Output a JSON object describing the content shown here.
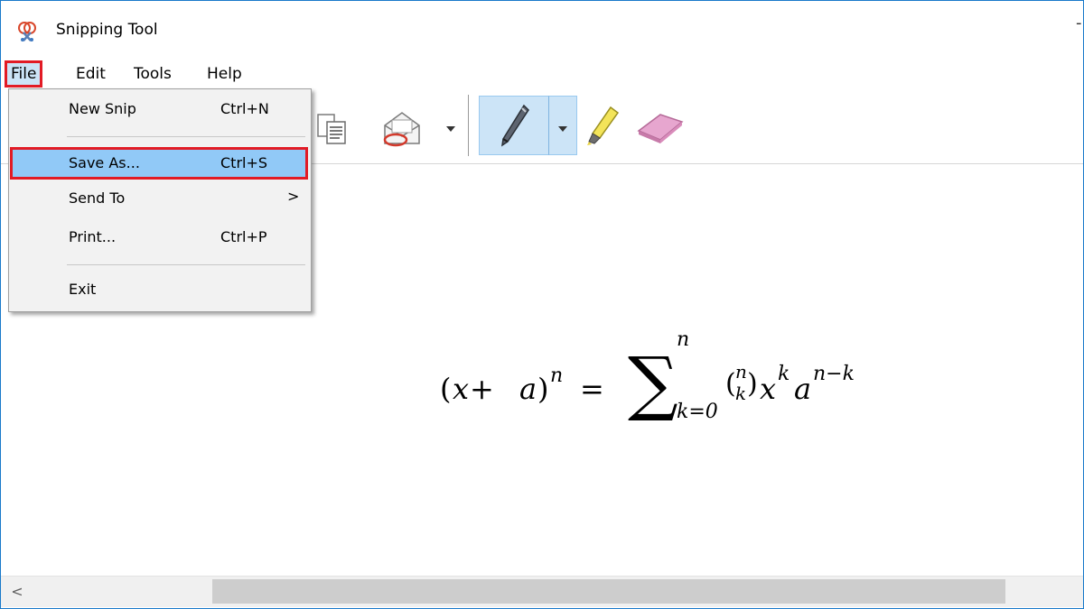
{
  "window": {
    "title": "Snipping Tool",
    "control_glyph": "-",
    "frame_color": "#1979ca"
  },
  "menubar": {
    "items": [
      {
        "label": "File"
      },
      {
        "label": "Edit"
      },
      {
        "label": "Tools"
      },
      {
        "label": "Help"
      }
    ]
  },
  "file_menu": {
    "items": [
      {
        "label": "New Snip",
        "shortcut": "Ctrl+N"
      },
      {
        "label": "Save As...",
        "shortcut": "Ctrl+S",
        "highlighted": true
      },
      {
        "label": "Send To",
        "submenu": ">"
      },
      {
        "label": "Print...",
        "shortcut": "Ctrl+P"
      },
      {
        "label": "Exit"
      }
    ]
  },
  "toolbar": {
    "icons": [
      "copy-icon",
      "send-snip-icon",
      "pen-icon",
      "highlighter-icon",
      "eraser-icon"
    ],
    "active_tool": "pen"
  },
  "canvas": {
    "formula": {
      "lhs_open": "(",
      "lhs_x": "x",
      "lhs_plus": " + ",
      "lhs_a": "a",
      "lhs_close": ")",
      "lhs_power": "n",
      "equals": "=",
      "sigma": "∑",
      "sum_upper": "n",
      "sum_lower": "k=0",
      "binom_top": "n",
      "binom_bottom": "k",
      "term_x": "x",
      "term_x_power": "k",
      "term_a": "a",
      "term_a_power": "n−k"
    }
  },
  "scrollbar": {
    "left_arrow": "<"
  },
  "colors": {
    "highlight_blue": "#cce4f7",
    "menu_highlight": "#91c9f7",
    "annotation_red": "#e21b25"
  }
}
